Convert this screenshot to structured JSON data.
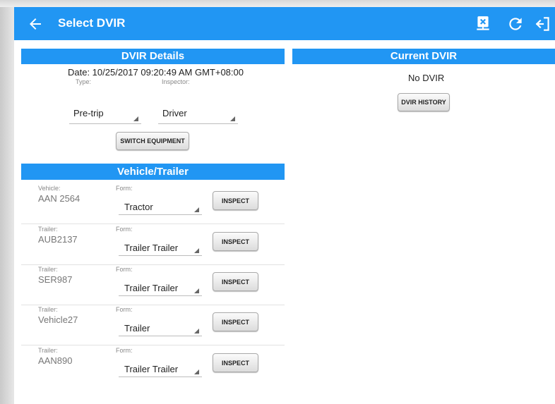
{
  "appbar": {
    "title": "Select DVIR",
    "back_icon": "arrow-left-icon",
    "actions": [
      "clear-dvir-icon",
      "refresh-icon",
      "logout-icon"
    ],
    "color": "#2196f3"
  },
  "dvir_details": {
    "header": "DVIR Details",
    "date": "Date: 10/25/2017 09:20:49 AM GMT+08:00",
    "type_label": "Type:",
    "type_value": "Pre-trip",
    "inspector_label": "Inspector:",
    "inspector_value": "Driver",
    "switch_button": "SWITCH EQUIPMENT"
  },
  "current_dvir": {
    "header": "Current DVIR",
    "status": "No DVIR",
    "history_button": "DVIR HISTORY"
  },
  "vehicle_trailer": {
    "header": "Vehicle/Trailer",
    "rows": [
      {
        "type_label": "Vehicle:",
        "name": "AAN 2564",
        "form_label": "Form:",
        "form": "Tractor",
        "button": "INSPECT"
      },
      {
        "type_label": "Trailer:",
        "name": "AUB2137",
        "form_label": "Form:",
        "form": "Trailer Trailer",
        "button": "INSPECT"
      },
      {
        "type_label": "Trailer:",
        "name": "SER987",
        "form_label": "Form:",
        "form": "Trailer Trailer",
        "button": "INSPECT"
      },
      {
        "type_label": "Trailer:",
        "name": "Vehicle27",
        "form_label": "Form:",
        "form": "Trailer",
        "button": "INSPECT"
      },
      {
        "type_label": "Trailer:",
        "name": "AAN890",
        "form_label": "Form:",
        "form": "Trailer Trailer",
        "button": "INSPECT"
      }
    ]
  }
}
